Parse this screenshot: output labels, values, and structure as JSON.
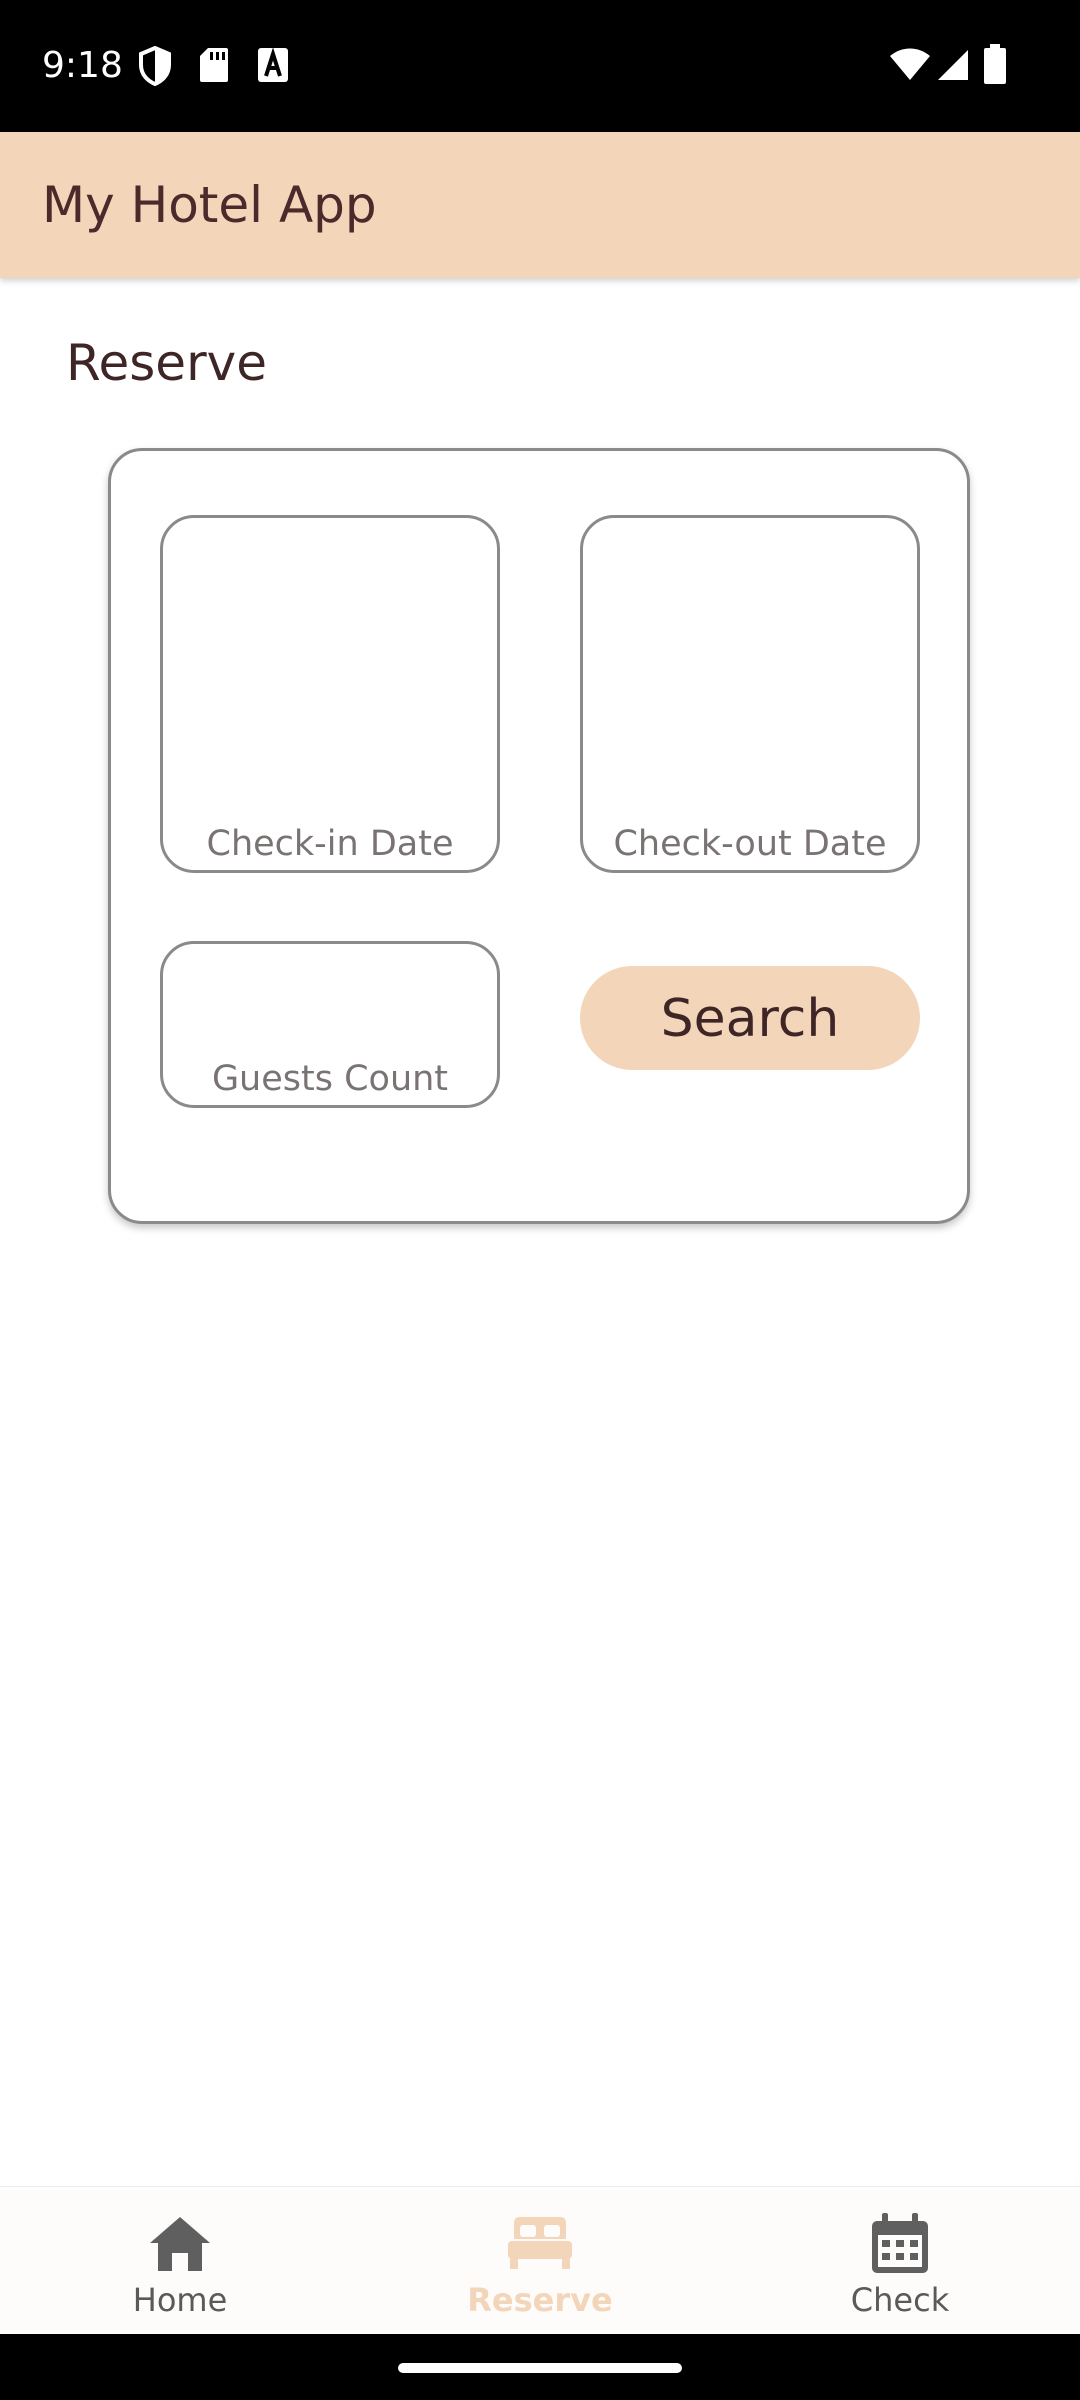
{
  "status_bar": {
    "time": "9:18",
    "left_icons": [
      "shield-icon",
      "sd-card-icon",
      "text-a-icon"
    ],
    "right_icons": [
      "wifi-icon",
      "signal-icon",
      "battery-icon"
    ]
  },
  "app_bar": {
    "title": "My Hotel App",
    "background": "#f3d5b9"
  },
  "page": {
    "section_title": "Reserve"
  },
  "form": {
    "checkin_label": "Check-in Date",
    "checkout_label": "Check-out Date",
    "guests_label": "Guests Count",
    "search_label": "Search"
  },
  "bottom_nav": {
    "items": [
      {
        "label": "Home",
        "icon": "home-icon",
        "active": false
      },
      {
        "label": "Reserve",
        "icon": "bed-icon",
        "active": true
      },
      {
        "label": "Check",
        "icon": "calendar-icon",
        "active": false
      }
    ],
    "active_color": "#f3d5b9"
  }
}
